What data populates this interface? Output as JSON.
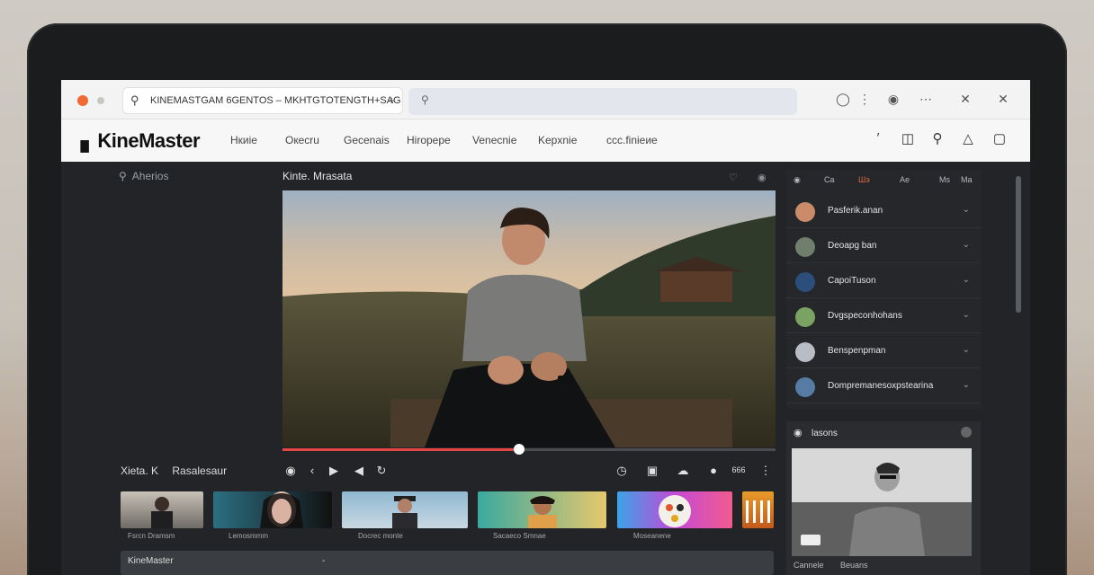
{
  "browser": {
    "address_text": "KINEMASTGAM 6GENTOS – MKHTGTOTENGTH+SAG",
    "omnibox_icon": "search-icon",
    "right_icons": [
      "help-icon",
      "more-icon",
      "extensions-icon",
      "users-icon",
      "close-tab-icon",
      "close-window-icon"
    ]
  },
  "app": {
    "logo_text": "KineMaster",
    "nav": [
      "Hкиie",
      "Oкecru",
      "Gecenais",
      "Hiropepe",
      "Venecnie",
      "Kepxnie",
      "ccc.finieиe"
    ],
    "header_icons": [
      "sparkle-icon",
      "share-icon",
      "search-icon",
      "user-icon",
      "panel-icon"
    ]
  },
  "left_panel": {
    "search_label": "Aherios"
  },
  "preview": {
    "title": "Kinte. Mrasata",
    "progress": 0.48
  },
  "timeline": {
    "label": "Xieta. K",
    "sublabel": "Rasalesaur",
    "thumbs": [
      {
        "label": "Fsrcn Dramsm"
      },
      {
        "label": "Lemosmmm"
      },
      {
        "label": "Docrec monte"
      },
      {
        "label": "Sacaeco Smnae"
      },
      {
        "label": "Moseanene"
      }
    ],
    "controls_right_text": "666"
  },
  "bottom_bar": {
    "label": "KineMaster",
    "right_mark": "-"
  },
  "right_panel": {
    "tabs": [
      "Ca",
      "Шэ",
      "Ae",
      "Ms",
      "Ma"
    ],
    "items": [
      {
        "label": "Pasferik.anan",
        "color": "#c98b6a"
      },
      {
        "label": "Deoapg ban",
        "color": "#6f7f6c"
      },
      {
        "label": "CapoiTuson",
        "color": "#2b4f7a"
      },
      {
        "label": "Dvgspeconhohans",
        "color": "#7aa262"
      },
      {
        "label": "Benspenpman",
        "color": "#b8bcc4"
      },
      {
        "label": "Dompremanesoxpstearina",
        "color": "#567ca4"
      }
    ],
    "card": {
      "title": "lasons",
      "caption_left": "Cannele",
      "caption_right": "Beuans"
    }
  }
}
